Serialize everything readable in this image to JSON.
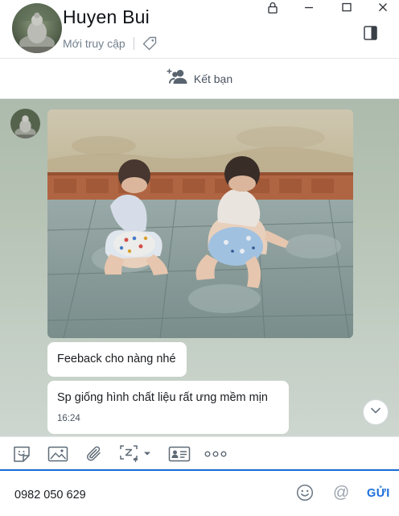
{
  "header": {
    "contact_name": "Huyen Bui",
    "status": "Mới truy cập"
  },
  "add_friend": {
    "label": "Kết bạn"
  },
  "messages": [
    {
      "type": "image"
    },
    {
      "type": "text",
      "text": "Feeback cho nàng nhé"
    },
    {
      "type": "text",
      "text": "Sp giống hình chất liệu rất ưng  mềm mịn",
      "time": "16:24"
    }
  ],
  "composer": {
    "input_value": "0982 050 629",
    "send_label": "GỬI"
  },
  "colors": {
    "accent": "#1a6fdb",
    "chat_background": "#b6c3b5",
    "icon": "#6b7784"
  },
  "icons": [
    "lock-icon",
    "minimize-icon",
    "maximize-icon",
    "close-icon",
    "tag-icon",
    "sidebar-toggle-icon",
    "add-friend-icon",
    "chevron-down-icon",
    "sticker-icon",
    "image-icon",
    "attachment-icon",
    "screenshot-icon",
    "contact-card-icon",
    "more-icon",
    "emoji-icon",
    "mention-icon"
  ]
}
